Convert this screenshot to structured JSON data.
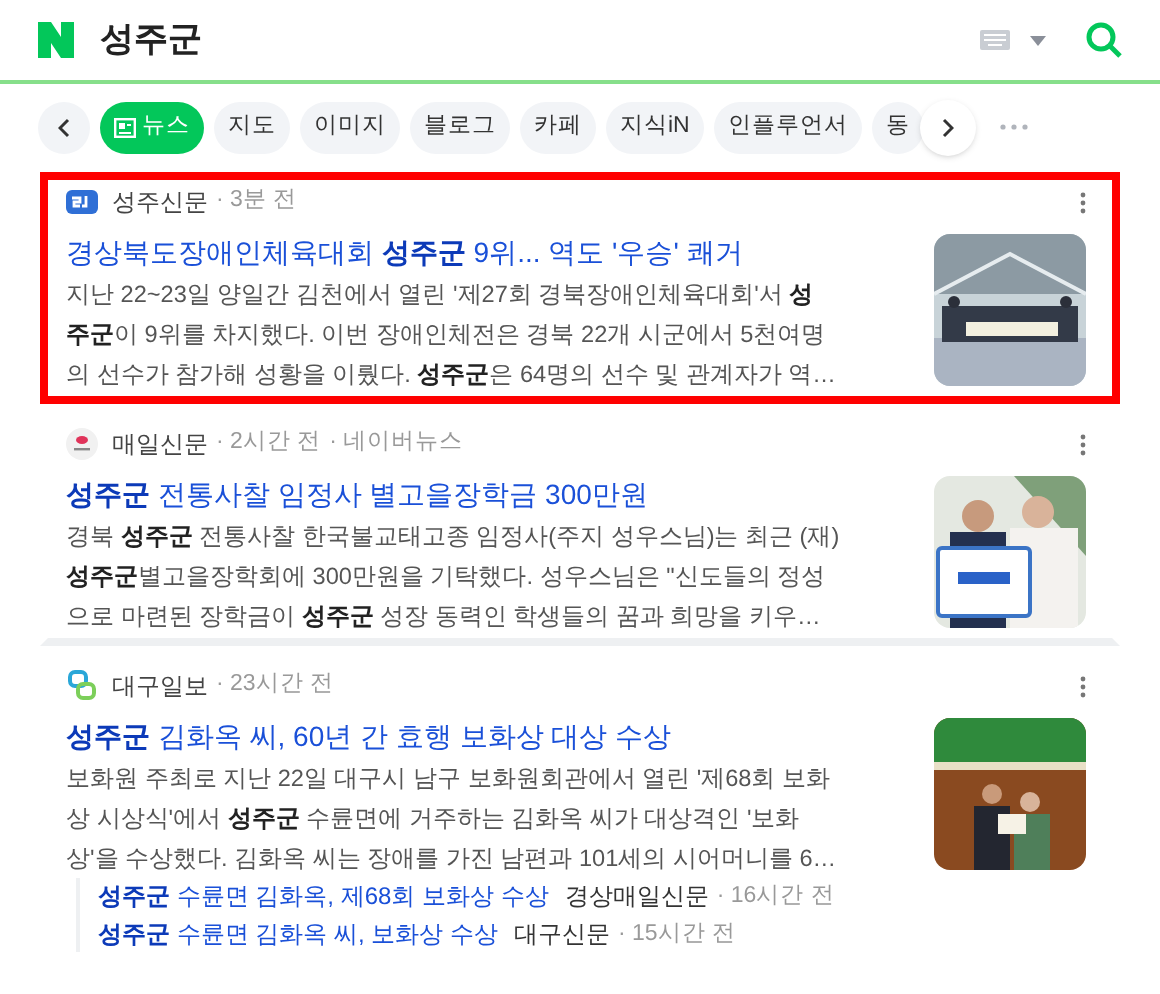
{
  "search": {
    "query": "성주군"
  },
  "tabs": [
    {
      "label": "뉴스",
      "selected": true
    },
    {
      "label": "지도",
      "selected": false
    },
    {
      "label": "이미지",
      "selected": false
    },
    {
      "label": "블로그",
      "selected": false
    },
    {
      "label": "카페",
      "selected": false
    },
    {
      "label": "지식iN",
      "selected": false
    },
    {
      "label": "인플루언서",
      "selected": false
    },
    {
      "label": "동",
      "selected": false
    }
  ],
  "articles": [
    {
      "source": "성주신문",
      "meta": [
        "· 3분 전"
      ],
      "highlighted": true,
      "title": "경상북도장애인체육대회 **성주군** 9위... 역도 '우승' 쾌거",
      "body": [
        "지난 22~23일 양일간 김천에서 열린 '제27회 경북장애인체육대회'서 **성**",
        "**주군**이 9위를 차지했다. 이번 장애인체전은 경북 22개 시군에서 5천여명",
        "의 선수가 참가해 성황을 이뤘다. **성주군**은 64명의 선수 및 관계자가 역…"
      ]
    },
    {
      "source": "매일신문",
      "meta": [
        "· 2시간 전",
        "· 네이버뉴스"
      ],
      "highlighted": false,
      "title": "**성주군** 전통사찰 임정사 별고을장학금 300만원",
      "body": [
        "경북 **성주군** 전통사찰 한국불교태고종 임정사(주지 성우스님)는 최근 (재)",
        "**성주군**별고을장학회에 300만원을 기탁했다. 성우스님은 \"신도들의 정성",
        "으로 마련된 장학금이 **성주군** 성장 동력인 학생들의 꿈과 희망을 키우…"
      ]
    },
    {
      "source": "대구일보",
      "meta": [
        "· 23시간 전"
      ],
      "highlighted": false,
      "title": "**성주군** 김화옥 씨, 60년 간 효행 보화상 대상 수상",
      "body": [
        "보화원 주최로 지난 22일 대구시 남구 보화원회관에서 열린 '제68회 보화",
        "상 시상식'에서 **성주군** 수륜면에 거주하는 김화옥 씨가 대상격인 '보화",
        "상'을 수상했다. 김화옥 씨는 장애를 가진 남편과 101세의 시어머니를 6…"
      ],
      "related": [
        {
          "title": "**성주군** 수륜면 김화옥, 제68회 보화상 수상",
          "source": "경상매일신문",
          "time": "· 16시간 전"
        },
        {
          "title": "**성주군** 수륜면 김화옥 씨, 보화상 수상",
          "source": "대구신문",
          "time": "· 15시간 전"
        }
      ]
    }
  ]
}
